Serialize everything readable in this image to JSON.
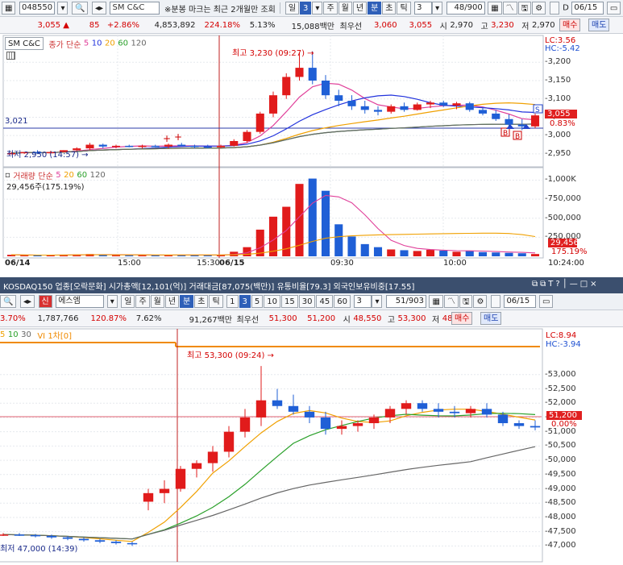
{
  "top": {
    "toolbar": {
      "code": "048550",
      "name": "SM C&C",
      "notice": "※분봉 마크는 최근 2개월만 조회",
      "periods": [
        "일",
        "3",
        "주",
        "월",
        "년",
        "분",
        "초",
        "틱"
      ],
      "interval": "3",
      "count": "48/900",
      "date": "06/15"
    },
    "quote": {
      "price": "3,055 ▲",
      "change": "85",
      "pct": "+2.86%",
      "volume": "4,853,892",
      "vol_ratio": "224.18%",
      "turnover": "5.13%",
      "amount": "15,088백만",
      "pref_label": "최우선",
      "ask": "3,060",
      "bid": "3,055",
      "open_label": "시",
      "open": "2,970",
      "high_label": "고",
      "high": "3,230",
      "low_label": "저",
      "low": "2,970",
      "buy": "매수",
      "sell": "매도"
    },
    "legend": {
      "name": "SM C&C",
      "ma_label": "종가 단순",
      "ma": [
        "5",
        "10",
        "20",
        "60",
        "120"
      ]
    },
    "right_info": {
      "lc": "LC:3.56",
      "hc": "HC:-5.42"
    },
    "high_note": "최고 3,230 (09:27) →",
    "low_note": "최저 2,950 (14:57) →",
    "level_label": "3,021",
    "price_axis": [
      "3,200",
      "3,150",
      "3,100",
      "3,050",
      "3,000",
      "2,950"
    ],
    "price_tag": "3,055",
    "pct_tag": "0.83%",
    "vol_legend": {
      "name": "거래량",
      "ma_label": "단순",
      "ma": [
        "5",
        "20",
        "60",
        "120"
      ]
    },
    "vol_info": "29,456주(175.19%)",
    "vol_axis": [
      "1,000K",
      "750,000",
      "500,000",
      "250,000"
    ],
    "vol_tag": "29,456",
    "vol_pct_tag": "175.19%",
    "time_axis": [
      "06/14",
      "15:00",
      "15:30",
      "06/15",
      "09:30",
      "10:00",
      "10:24:00"
    ],
    "chart_data": {
      "type": "candlestick",
      "title": "SM C&C",
      "ma_periods": [
        5,
        10,
        20,
        60,
        120
      ],
      "ylim": [
        2930,
        3260
      ],
      "high": 3230,
      "low": 2950,
      "candles": [
        {
          "o": 2950,
          "h": 2955,
          "l": 2950,
          "c": 2952
        },
        {
          "o": 2952,
          "h": 2955,
          "l": 2950,
          "c": 2955
        },
        {
          "o": 2955,
          "h": 2960,
          "l": 2950,
          "c": 2952
        },
        {
          "o": 2952,
          "h": 2958,
          "l": 2950,
          "c": 2955
        },
        {
          "o": 2955,
          "h": 2960,
          "l": 2955,
          "c": 2960
        },
        {
          "o": 2960,
          "h": 2968,
          "l": 2958,
          "c": 2965
        },
        {
          "o": 2965,
          "h": 2980,
          "l": 2960,
          "c": 2975
        },
        {
          "o": 2975,
          "h": 2978,
          "l": 2965,
          "c": 2970
        },
        {
          "o": 2970,
          "h": 2975,
          "l": 2965,
          "c": 2972
        },
        {
          "o": 2972,
          "h": 2975,
          "l": 2968,
          "c": 2970
        },
        {
          "o": 2970,
          "h": 2975,
          "l": 2965,
          "c": 2972
        },
        {
          "o": 2972,
          "h": 2975,
          "l": 2968,
          "c": 2970
        },
        {
          "o": 2970,
          "h": 2978,
          "l": 2965,
          "c": 2975
        },
        {
          "o": 2975,
          "h": 2980,
          "l": 2970,
          "c": 2972
        },
        {
          "o": 2972,
          "h": 2975,
          "l": 2965,
          "c": 2970
        },
        {
          "o": 2970,
          "h": 2975,
          "l": 2965,
          "c": 2968
        },
        {
          "o": 2968,
          "h": 2975,
          "l": 2965,
          "c": 2972
        },
        {
          "o": 2972,
          "h": 2990,
          "l": 2970,
          "c": 2985
        },
        {
          "o": 2985,
          "h": 3015,
          "l": 2980,
          "c": 3010
        },
        {
          "o": 3010,
          "h": 3065,
          "l": 3005,
          "c": 3060
        },
        {
          "o": 3060,
          "h": 3120,
          "l": 3050,
          "c": 3110
        },
        {
          "o": 3110,
          "h": 3170,
          "l": 3100,
          "c": 3160
        },
        {
          "o": 3160,
          "h": 3225,
          "l": 3150,
          "c": 3185
        },
        {
          "o": 3185,
          "h": 3230,
          "l": 3140,
          "c": 3150
        },
        {
          "o": 3150,
          "h": 3165,
          "l": 3100,
          "c": 3110
        },
        {
          "o": 3110,
          "h": 3125,
          "l": 3080,
          "c": 3095
        },
        {
          "o": 3095,
          "h": 3110,
          "l": 3070,
          "c": 3080
        },
        {
          "o": 3080,
          "h": 3095,
          "l": 3060,
          "c": 3070
        },
        {
          "o": 3070,
          "h": 3080,
          "l": 3055,
          "c": 3065
        },
        {
          "o": 3065,
          "h": 3085,
          "l": 3060,
          "c": 3080
        },
        {
          "o": 3080,
          "h": 3090,
          "l": 3065,
          "c": 3070
        },
        {
          "o": 3070,
          "h": 3090,
          "l": 3068,
          "c": 3085
        },
        {
          "o": 3085,
          "h": 3095,
          "l": 3075,
          "c": 3090
        },
        {
          "o": 3090,
          "h": 3095,
          "l": 3078,
          "c": 3082
        },
        {
          "o": 3082,
          "h": 3092,
          "l": 3072,
          "c": 3088
        },
        {
          "o": 3088,
          "h": 3092,
          "l": 3065,
          "c": 3070
        },
        {
          "o": 3070,
          "h": 3078,
          "l": 3055,
          "c": 3060
        },
        {
          "o": 3060,
          "h": 3070,
          "l": 3040,
          "c": 3045
        },
        {
          "o": 3045,
          "h": 3058,
          "l": 3025,
          "c": 3030
        },
        {
          "o": 3030,
          "h": 3045,
          "l": 3015,
          "c": 3025
        },
        {
          "o": 3025,
          "h": 3060,
          "l": 3020,
          "c": 3055
        }
      ],
      "volumes": [
        20,
        15,
        12,
        18,
        22,
        25,
        30,
        18,
        15,
        14,
        16,
        15,
        20,
        18,
        15,
        14,
        16,
        60,
        120,
        350,
        520,
        650,
        950,
        1020,
        860,
        420,
        260,
        160,
        120,
        90,
        80,
        70,
        85,
        75,
        60,
        70,
        55,
        50,
        45,
        40,
        30
      ]
    }
  },
  "bottom": {
    "titlebar": {
      "text": "KOSDAQ150 업종[오락문화] 시가총액[12,101(억)] 거래대금[87,075(백만)] 유통비율[79.3] 외국인보유비중[17.55]"
    },
    "toolbar": {
      "name": "에스엠",
      "periods": [
        "일",
        "주",
        "월",
        "년",
        "분",
        "초",
        "틱"
      ],
      "intervals": [
        "1",
        "3",
        "5",
        "10",
        "15",
        "30",
        "45",
        "60"
      ],
      "interval": "3",
      "count": "51/903",
      "date": "06/15"
    },
    "quote": {
      "pct0": "3.70%",
      "volume": "1,787,766",
      "vol_ratio": "120.87%",
      "turnover": "7.62%",
      "amount": "91,267백만",
      "pref_label": "최우선",
      "ask": "51,300",
      "bid": "51,200",
      "open_label": "시",
      "open": "48,550",
      "high_label": "고",
      "high": "53,300",
      "low_label": "저",
      "low": "48,250",
      "buy": "매수",
      "sell": "매도"
    },
    "legend": {
      "ma": [
        "5",
        "10",
        "30"
      ],
      "vi": "VI 1차[0]"
    },
    "right_info": {
      "lc": "LC:8.94",
      "hc": "HC:-3.94"
    },
    "high_note": "최고 53,300 (09:24) →",
    "low_note": "최저 47,000 (14:39)",
    "price_axis": [
      "53,000",
      "52,500",
      "52,000",
      "51,500",
      "51,000",
      "50,500",
      "50,000",
      "49,500",
      "49,000",
      "48,500",
      "48,000",
      "47,500",
      "47,000"
    ],
    "price_tag": "51,200",
    "pct_tag": "0.00%",
    "chart_data": {
      "type": "candlestick",
      "title": "에스엠",
      "ma_periods": [
        5,
        10,
        30
      ],
      "ylim": [
        46700,
        53700
      ],
      "high": 53300,
      "low": 47000,
      "candles": [
        {
          "o": 47400,
          "h": 47450,
          "l": 47350,
          "c": 47400
        },
        {
          "o": 47400,
          "h": 47450,
          "l": 47350,
          "c": 47380
        },
        {
          "o": 47380,
          "h": 47420,
          "l": 47300,
          "c": 47350
        },
        {
          "o": 47350,
          "h": 47400,
          "l": 47250,
          "c": 47300
        },
        {
          "o": 47300,
          "h": 47350,
          "l": 47200,
          "c": 47250
        },
        {
          "o": 47250,
          "h": 47300,
          "l": 47150,
          "c": 47200
        },
        {
          "o": 47200,
          "h": 47250,
          "l": 47100,
          "c": 47150
        },
        {
          "o": 47150,
          "h": 47200,
          "l": 47050,
          "c": 47100
        },
        {
          "o": 47100,
          "h": 47150,
          "l": 47000,
          "c": 47080
        },
        {
          "o": 48550,
          "h": 49000,
          "l": 48250,
          "c": 48850
        },
        {
          "o": 48850,
          "h": 49300,
          "l": 48500,
          "c": 49000
        },
        {
          "o": 49000,
          "h": 49800,
          "l": 48900,
          "c": 49700
        },
        {
          "o": 49700,
          "h": 50000,
          "l": 49400,
          "c": 49900
        },
        {
          "o": 49900,
          "h": 50500,
          "l": 49600,
          "c": 50300
        },
        {
          "o": 50300,
          "h": 51200,
          "l": 50100,
          "c": 51000
        },
        {
          "o": 51000,
          "h": 51800,
          "l": 50800,
          "c": 51500
        },
        {
          "o": 51500,
          "h": 53300,
          "l": 51200,
          "c": 52100
        },
        {
          "o": 52100,
          "h": 52500,
          "l": 51800,
          "c": 51900
        },
        {
          "o": 51900,
          "h": 52300,
          "l": 51600,
          "c": 51700
        },
        {
          "o": 51700,
          "h": 51900,
          "l": 51300,
          "c": 51500
        },
        {
          "o": 51500,
          "h": 51700,
          "l": 50900,
          "c": 51100
        },
        {
          "o": 51100,
          "h": 51400,
          "l": 50900,
          "c": 51200
        },
        {
          "o": 51200,
          "h": 51400,
          "l": 51000,
          "c": 51300
        },
        {
          "o": 51300,
          "h": 51600,
          "l": 51100,
          "c": 51500
        },
        {
          "o": 51500,
          "h": 51900,
          "l": 51300,
          "c": 51800
        },
        {
          "o": 51800,
          "h": 52100,
          "l": 51600,
          "c": 52000
        },
        {
          "o": 52000,
          "h": 52100,
          "l": 51700,
          "c": 51800
        },
        {
          "o": 51800,
          "h": 52000,
          "l": 51500,
          "c": 51700
        },
        {
          "o": 51700,
          "h": 51900,
          "l": 51500,
          "c": 51650
        },
        {
          "o": 51650,
          "h": 51900,
          "l": 51500,
          "c": 51800
        },
        {
          "o": 51800,
          "h": 52000,
          "l": 51500,
          "c": 51600
        },
        {
          "o": 51600,
          "h": 51700,
          "l": 51200,
          "c": 51300
        },
        {
          "o": 51300,
          "h": 51400,
          "l": 51100,
          "c": 51200
        },
        {
          "o": 51200,
          "h": 51400,
          "l": 51050,
          "c": 51150
        }
      ]
    }
  }
}
